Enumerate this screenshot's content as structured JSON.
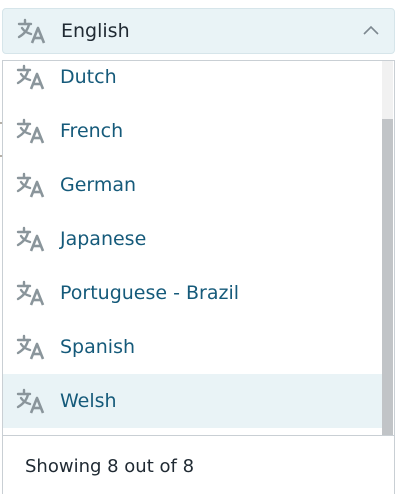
{
  "selector": {
    "icon": "translate-icon",
    "label": "English",
    "chevron": "chevron-up-icon"
  },
  "dropdown": {
    "items": [
      {
        "label": "Dutch",
        "icon": "translate-icon"
      },
      {
        "label": "French",
        "icon": "translate-icon"
      },
      {
        "label": "German",
        "icon": "translate-icon"
      },
      {
        "label": "Japanese",
        "icon": "translate-icon"
      },
      {
        "label": "Portuguese - Brazil",
        "icon": "translate-icon"
      },
      {
        "label": "Spanish",
        "icon": "translate-icon"
      },
      {
        "label": "Welsh",
        "icon": "translate-icon",
        "highlighted": true
      }
    ],
    "footer": "Showing 8 out of 8"
  },
  "colors": {
    "item_text": "#155a7a",
    "icon": "#8a959b",
    "selector_bg": "#e9f3f6",
    "highlight_bg": "#e9f3f6"
  }
}
